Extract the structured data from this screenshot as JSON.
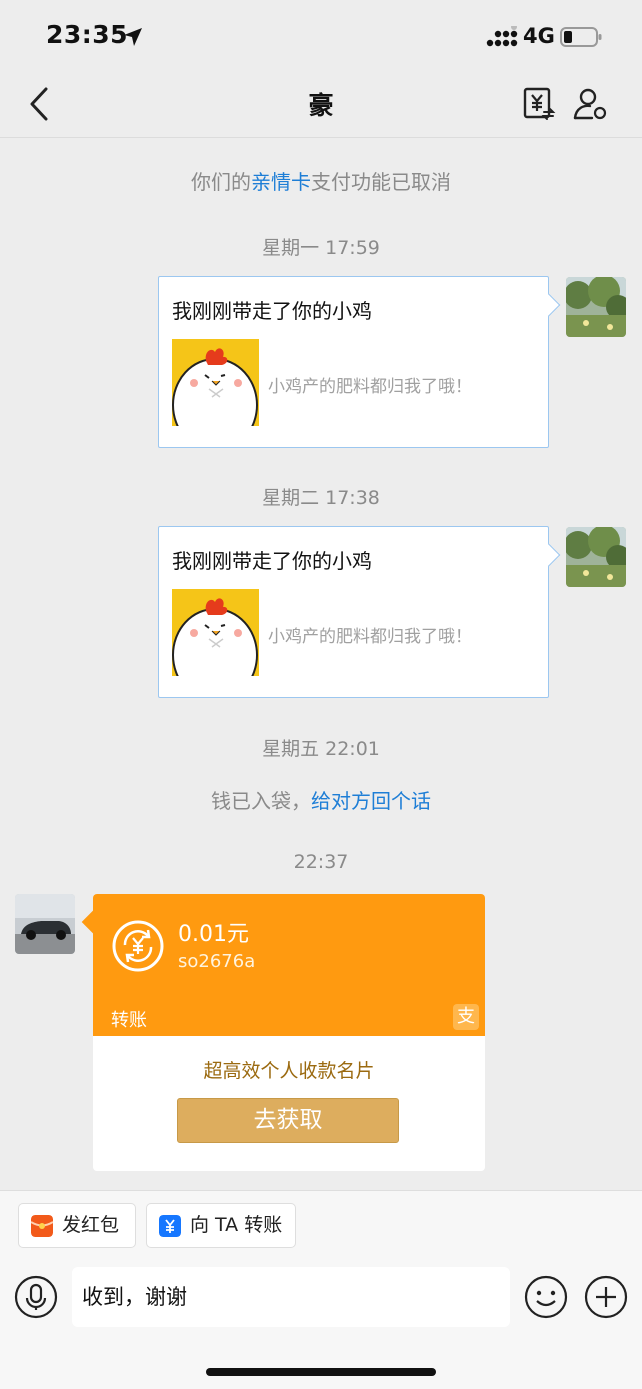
{
  "status_bar": {
    "time": "23:35",
    "network": "4G"
  },
  "nav": {
    "title": "豪"
  },
  "chat": {
    "notice_1": {
      "prefix": "你们的",
      "link": "亲情卡",
      "suffix": "支付功能已取消"
    },
    "timestamp_1": "星期一 17:59",
    "card_1": {
      "title": "我刚刚带走了你的小鸡",
      "desc": "小鸡产的肥料都归我了哦！"
    },
    "timestamp_2": "星期二 17:38",
    "card_2": {
      "title": "我刚刚带走了你的小鸡",
      "desc": "小鸡产的肥料都归我了哦！"
    },
    "timestamp_3": "星期五 22:01",
    "notice_2": {
      "prefix": "钱已入袋，",
      "link": "给对方回个话"
    },
    "timestamp_4": "22:37",
    "transfer": {
      "amount": "0.01元",
      "memo": "so2676a",
      "label": "转账",
      "logo": "支",
      "promo_text": "超高效个人收款名片",
      "promo_button": "去获取"
    }
  },
  "bottom": {
    "red_packet_label": "发红包",
    "transfer_label": "向 TA 转账",
    "input_value": "收到，谢谢"
  },
  "colors": {
    "accent_link": "#1e7ed6",
    "transfer_orange": "#ff9a10",
    "promo_gold": "#ddad5e",
    "red_packet": "#f25a1a",
    "transfer_blue": "#1677ff"
  }
}
